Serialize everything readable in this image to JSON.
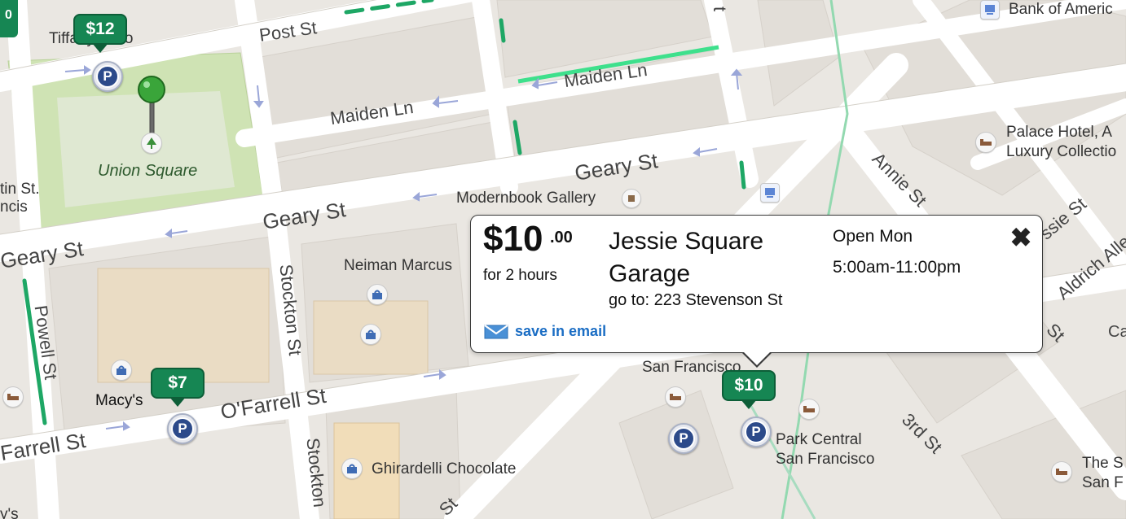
{
  "streets": {
    "post_st": "Post St",
    "maiden_ln_1": "Maiden Ln",
    "maiden_ln_2": "Maiden Ln",
    "geary_st_1": "Geary St",
    "geary_st_2": "Geary St",
    "geary_st_3": "Geary St",
    "ofarrell_st_1": "O'Farrell St",
    "ofarrell_st_2": "Farrell St",
    "stockton_st_1": "Stockton St",
    "stockton_st_2": "Stockton",
    "powell_st": "Powell St",
    "annie_st": "Annie St",
    "jessie_st": "ssie St",
    "aldrich_alley": "Aldrich Alle",
    "third_st": "3rd St",
    "st_fragment": "St",
    "st_fragment_2": "St",
    "t_fragment": "t",
    "ca_fragment": "Ca",
    "ys_fragment": "y's"
  },
  "places": {
    "union_square": "Union Square",
    "modernbook": "Modernbook Gallery",
    "neiman_marcus": "Neiman Marcus",
    "macys": "Macy's",
    "ghirardelli": "Ghirardelli Chocolate",
    "san_francisco": "San Francisco",
    "park_central_1": "Park Central",
    "park_central_2": "San Francisco",
    "palace_hotel_1": "Palace Hotel, A",
    "palace_hotel_2": "Luxury Collectio",
    "bank_of_america": "Bank of Americ",
    "tiffany": "Tiffany & Co",
    "the_st_1": "The S",
    "the_st_2": "San F",
    "westin_1": "tin St.",
    "westin_2": "ncis",
    "corner_badge": "0"
  },
  "price_tags": {
    "tag_12": "$12",
    "tag_7": "$7",
    "tag_10": "$10"
  },
  "parking_symbol": "P",
  "infowindow": {
    "price": "$10",
    "cents": ".00",
    "duration": "for 2 hours",
    "garage_name": "Jessie Square Garage",
    "goto": "go to: 223 Stevenson St",
    "open_days": "Open Mon",
    "open_hours": "5:00am-11:00pm",
    "close_symbol": "✖",
    "save_email": "save in email"
  },
  "colors": {
    "price_tag_green": "#168653",
    "parking_blue": "#2c4a8a",
    "link_blue": "#1a6dc4",
    "park_green": "#cfe3b4",
    "traffic_green": "#1ea765"
  }
}
